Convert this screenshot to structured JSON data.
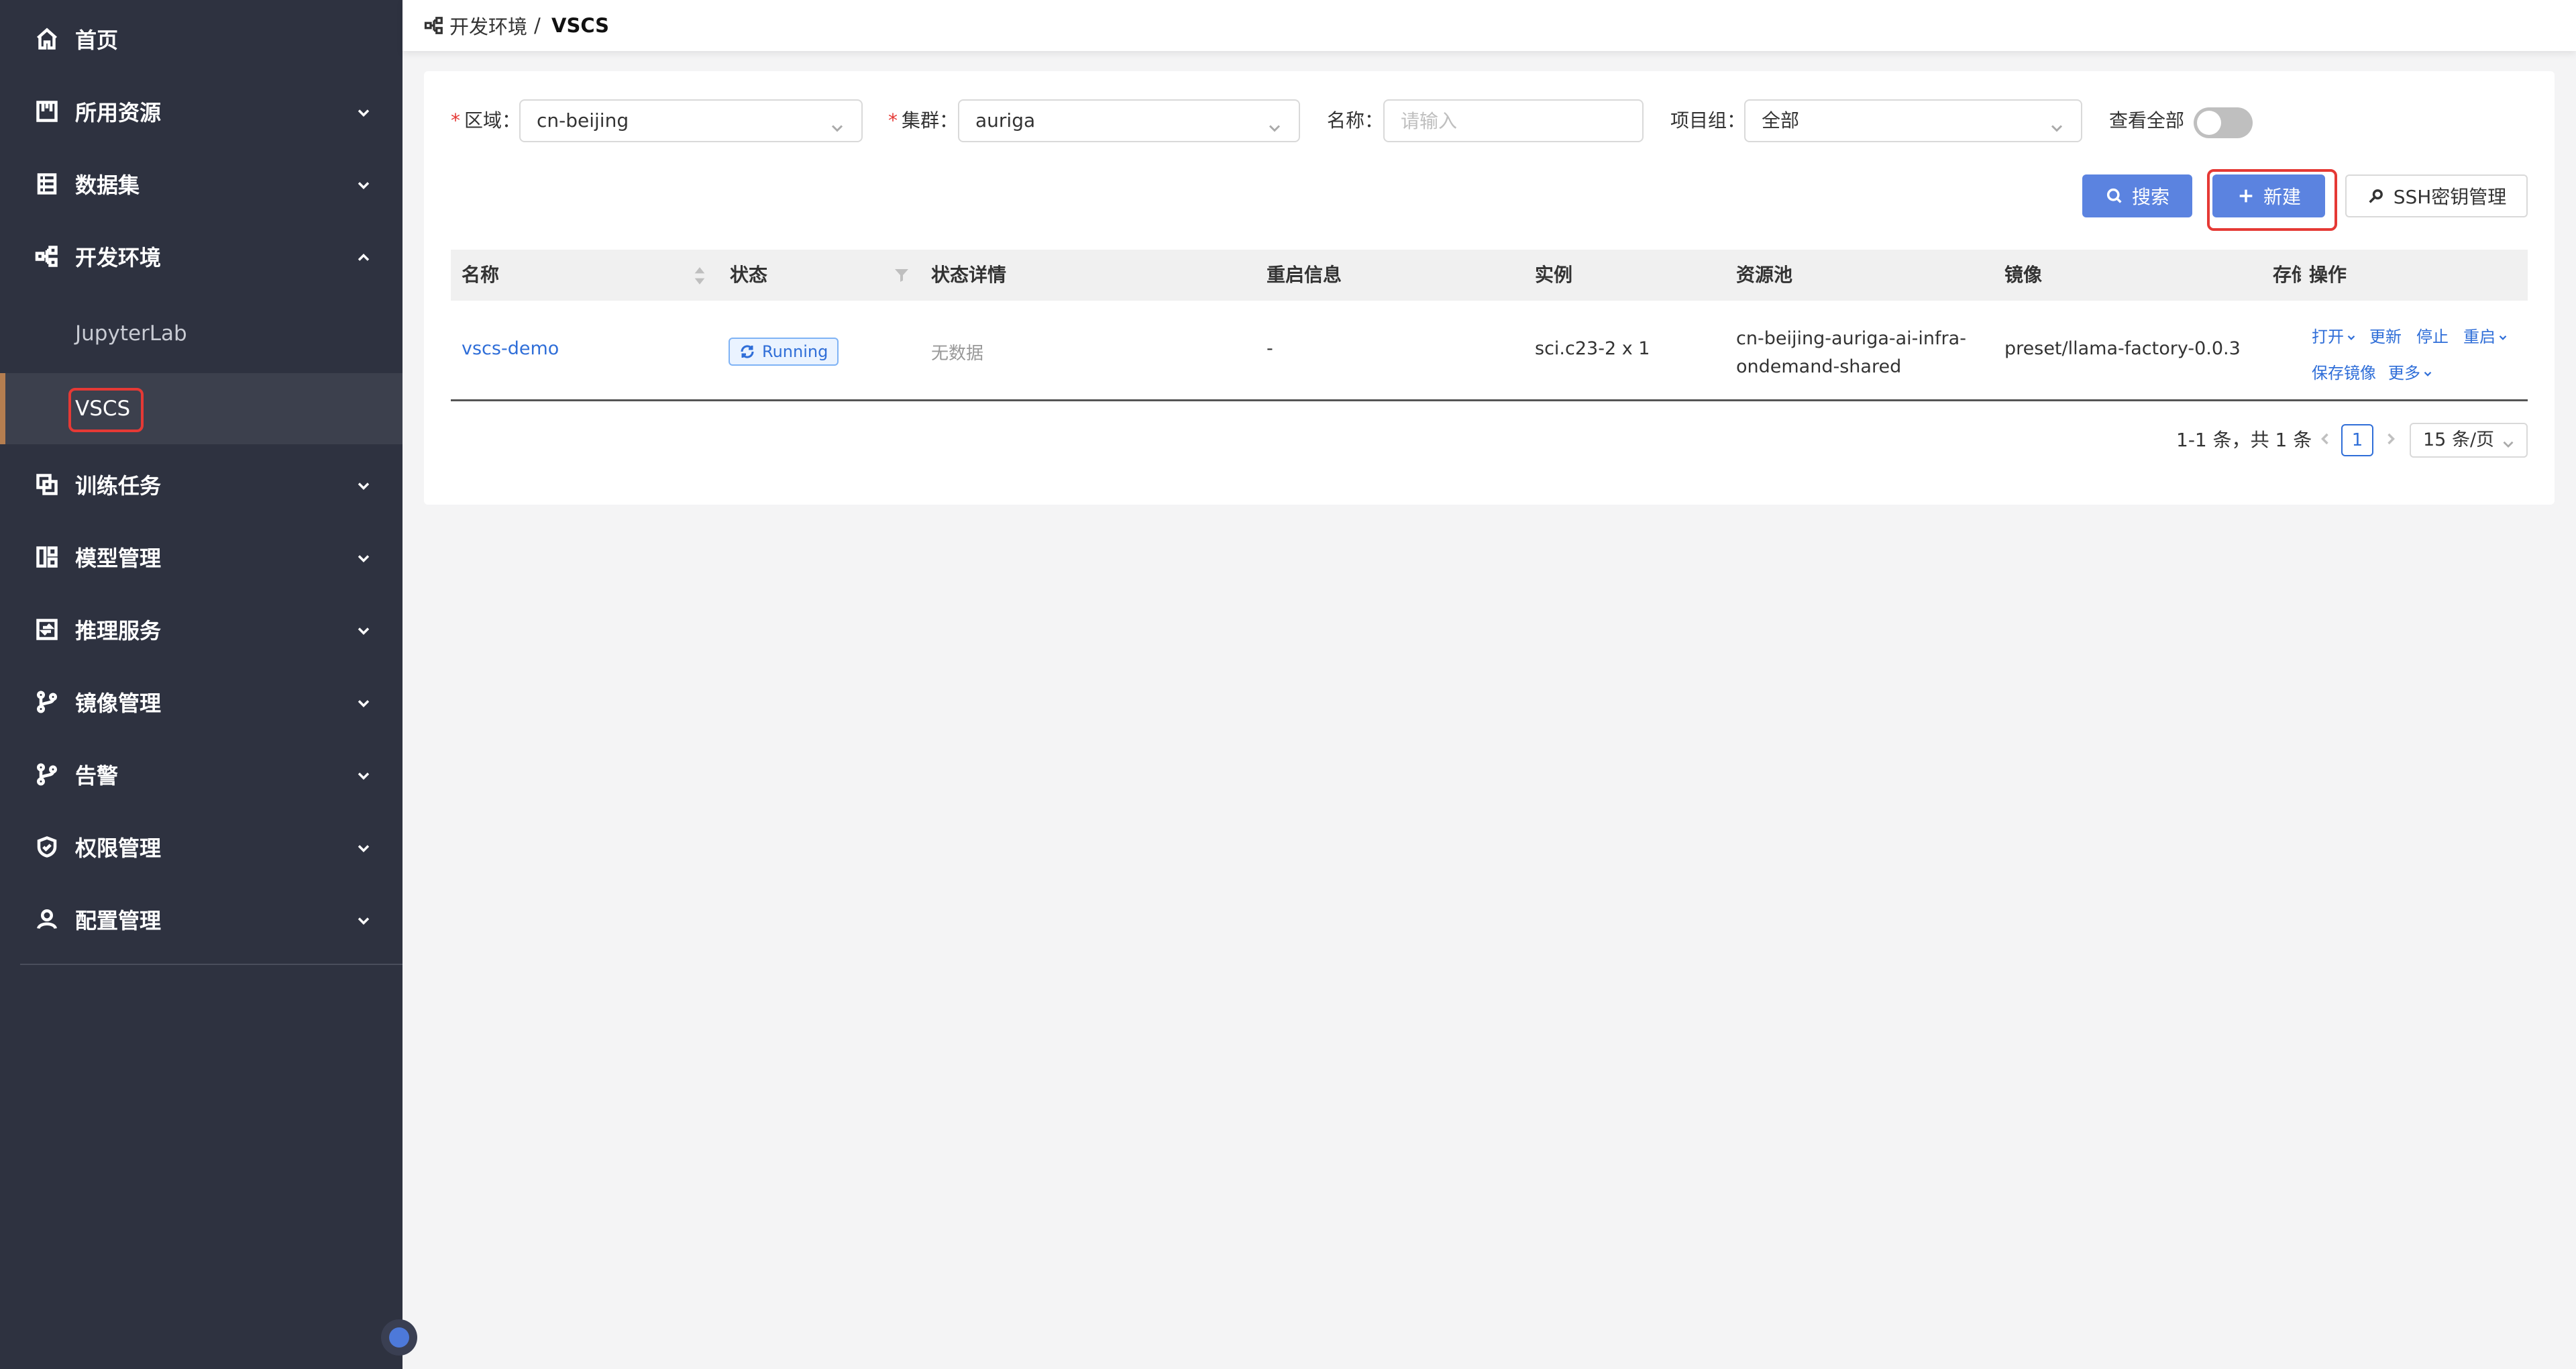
{
  "sidebar": {
    "items": [
      {
        "label": "首页",
        "icon": "home-icon"
      },
      {
        "label": "所用资源",
        "icon": "resource-icon"
      },
      {
        "label": "数据集",
        "icon": "dataset-icon"
      },
      {
        "label": "开发环境",
        "icon": "dev-env-icon"
      },
      {
        "label": "训练任务",
        "icon": "training-icon"
      },
      {
        "label": "模型管理",
        "icon": "model-icon"
      },
      {
        "label": "推理服务",
        "icon": "inference-icon"
      },
      {
        "label": "镜像管理",
        "icon": "branch-icon"
      },
      {
        "label": "告警",
        "icon": "branch-icon"
      },
      {
        "label": "权限管理",
        "icon": "shield-icon"
      },
      {
        "label": "配置管理",
        "icon": "user-icon"
      }
    ],
    "subitems": [
      {
        "label": "JupyterLab"
      },
      {
        "label": "VSCS"
      }
    ]
  },
  "breadcrumb": {
    "parent": "开发环境",
    "separator": "/",
    "current": "VSCS"
  },
  "filters": {
    "region_label": "区域：",
    "region_value": "cn-beijing",
    "cluster_label": "集群：",
    "cluster_value": "auriga",
    "name_label": "名称：",
    "name_placeholder": "请输入",
    "project_label": "项目组：",
    "project_value": "全部",
    "view_all_label": "查看全部"
  },
  "buttons": {
    "search": "搜索",
    "create": "新建",
    "ssh": "SSH密钥管理"
  },
  "table": {
    "headers": [
      "名称",
      "状态",
      "状态详情",
      "重启信息",
      "实例",
      "资源池",
      "镜像",
      "存储",
      "操作"
    ],
    "rows": [
      {
        "name": "vscs-demo",
        "status": "Running",
        "status_detail": "无数据",
        "restart": "-",
        "instance": "sci.c23-2 x 1",
        "pool_line1": "cn-beijing-auriga-ai-infra-",
        "pool_line2": "ondemand-shared",
        "image": "preset/llama-factory-0.0.3",
        "ops": {
          "open": "打开",
          "update": "更新",
          "stop": "停止",
          "restart": "重启",
          "save_image": "保存镜像",
          "more": "更多"
        }
      }
    ]
  },
  "pagination": {
    "summary": "1-1 条，共 1 条",
    "current_page": "1",
    "page_size": "15 条/页"
  },
  "colors": {
    "sidebar_bg": "#2e3240",
    "primary": "#5b83e0",
    "link": "#2f6ed8",
    "highlight": "#e53935"
  }
}
